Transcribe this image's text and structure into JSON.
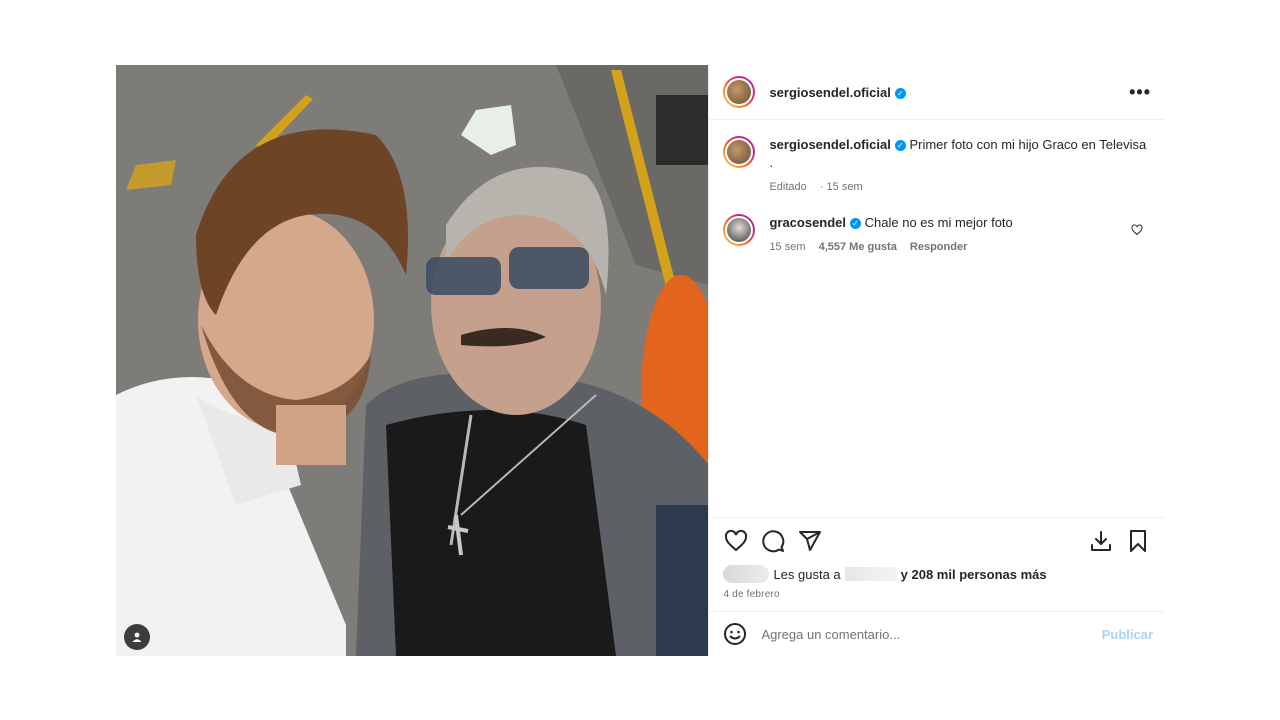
{
  "post": {
    "author": "sergiosendel.oficial",
    "caption_author": "sergiosendel.oficial",
    "caption_text": "Primer foto con mi hijo Graco en Televisa .",
    "caption_edited": "Editado",
    "caption_time": "15 sem",
    "comment": {
      "author": "gracosendel",
      "text": "Chale no es mi mejor foto",
      "time": "15 sem",
      "likes": "4,557 Me gusta",
      "reply": "Responder"
    },
    "likes_prefix": "Les gusta a",
    "likes_suffix": "y 208 mil personas más",
    "date": "4 de febrero",
    "comment_placeholder": "Agrega un comentario...",
    "publish": "Publicar",
    "more": "•••"
  },
  "colors": {
    "verified": "#0095f6",
    "publish_disabled": "#a6d3f7"
  },
  "icons": [
    "more-options-icon",
    "verified-badge-icon",
    "heart-icon",
    "comment-icon",
    "share-icon",
    "download-icon",
    "bookmark-icon",
    "emoji-icon",
    "user-tag-icon"
  ]
}
